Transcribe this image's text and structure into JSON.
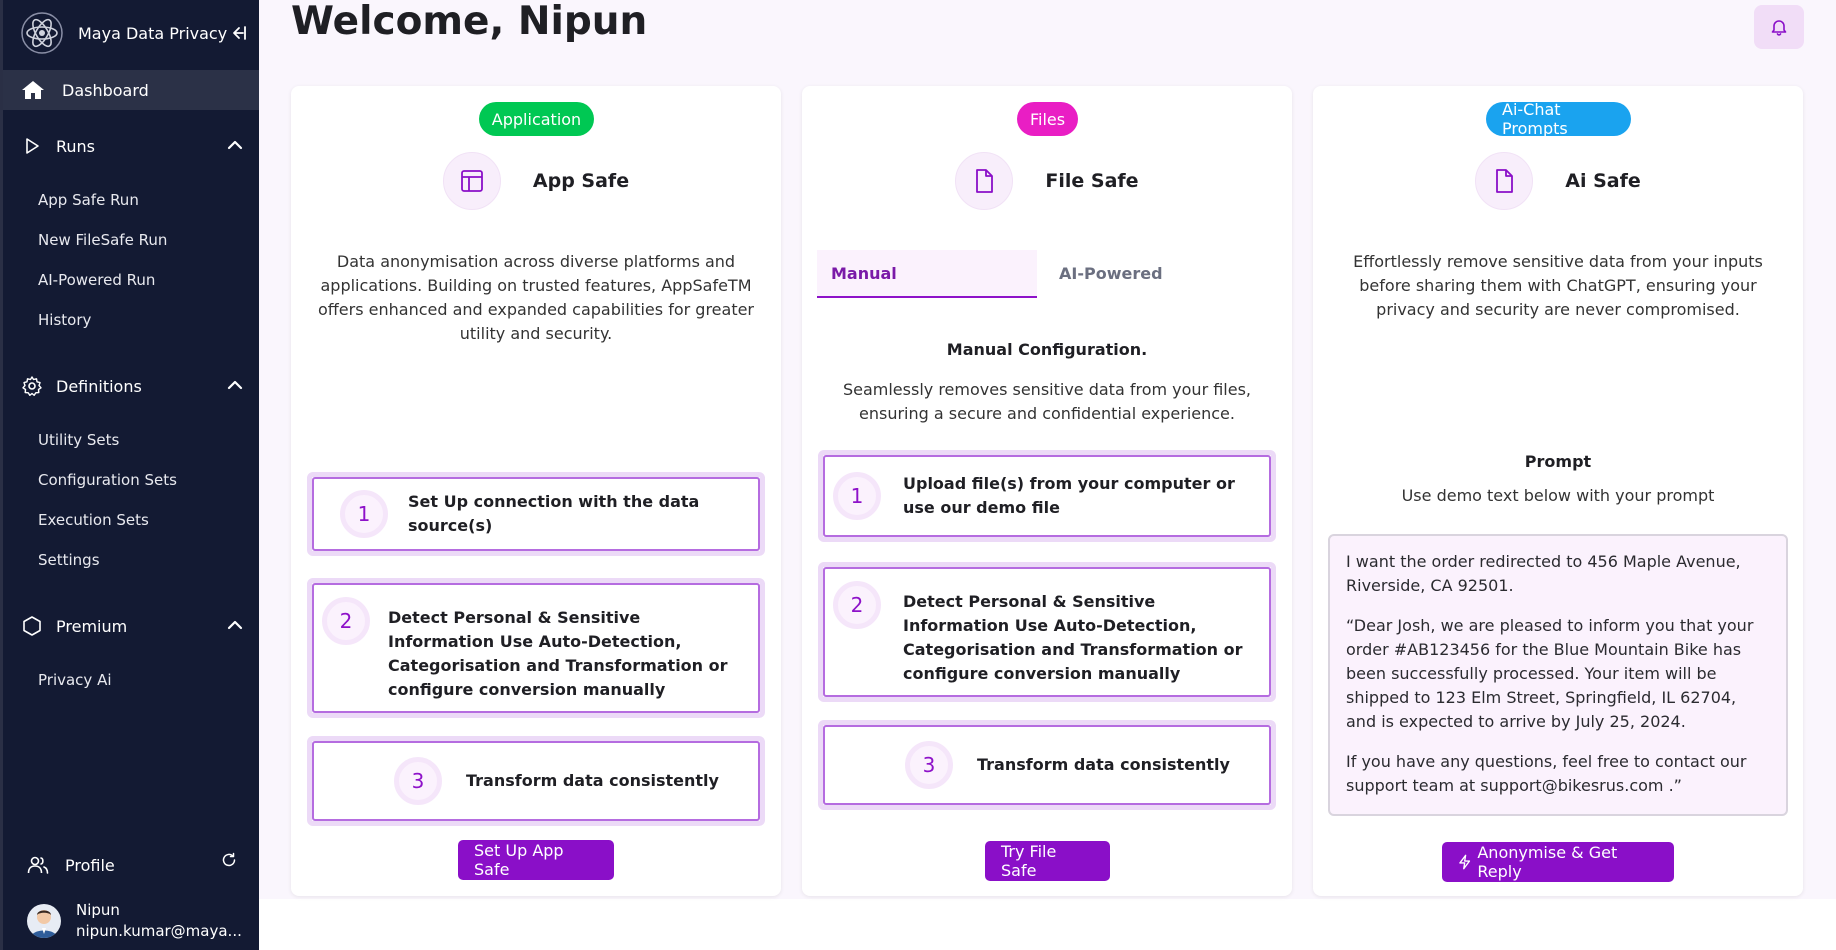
{
  "app": {
    "name": "Maya Data Privacy"
  },
  "sidebar": {
    "dashboard_label": "Dashboard",
    "runs": {
      "label": "Runs",
      "items": [
        "App Safe Run",
        "New FileSafe Run",
        "AI-Powered Run",
        "History"
      ]
    },
    "definitions": {
      "label": "Definitions",
      "items": [
        "Utility Sets",
        "Configuration Sets",
        "Execution Sets",
        "Settings"
      ]
    },
    "premium": {
      "label": "Premium",
      "items": [
        "Privacy Ai"
      ]
    },
    "profile_label": "Profile",
    "user": {
      "name": "Nipun",
      "email": "nipun.kumar@maya..."
    }
  },
  "header": {
    "title": "Welcome, Nipun"
  },
  "cards": {
    "app": {
      "pill": "Application",
      "title": "App Safe",
      "description": "Data anonymisation across diverse platforms and applications. Building on trusted features, AppSafeTM offers enhanced and expanded capabilities for greater utility and security.",
      "steps": [
        {
          "num": "1",
          "text": "Set Up connection with the data source(s)"
        },
        {
          "num": "2",
          "text": "Detect Personal & Sensitive Information Use Auto-Detection, Categorisation and Transformation or configure conversion manually"
        },
        {
          "num": "3",
          "text": "Transform data consistently"
        }
      ],
      "button": "Set Up App Safe"
    },
    "file": {
      "pill": "Files",
      "title": "File Safe",
      "tabs": [
        "Manual",
        "AI-Powered"
      ],
      "config_title": "Manual Configuration.",
      "description": "Seamlessly removes sensitive data from your files, ensuring a secure and confidential experience.",
      "steps": [
        {
          "num": "1",
          "text": "Upload file(s) from your computer or use our demo file"
        },
        {
          "num": "2",
          "text": "Detect Personal & Sensitive Information Use Auto-Detection, Categorisation and Transformation or configure conversion manually"
        },
        {
          "num": "3",
          "text": "Transform data consistently"
        }
      ],
      "button": "Try File Safe"
    },
    "ai": {
      "pill": "Ai-Chat Prompts",
      "title": "Ai Safe",
      "description": "Effortlessly remove sensitive data from your inputs before sharing them with ChatGPT, ensuring your privacy and security are never compromised.",
      "prompt_title": "Prompt",
      "prompt_subtitle": "Use demo text below with your prompt",
      "prompt_paragraphs": [
        "I want the order redirected to 456 Maple Avenue, Riverside, CA 92501.",
        "“Dear Josh, we are pleased to inform you that your order #AB123456 for the Blue Mountain Bike has been successfully processed. Your item will be shipped to 123 Elm Street, Springfield, IL 62704, and is expected to arrive by July 25, 2024.",
        "If you have any questions, feel free to contact our support team at support@bikesrus.com .”"
      ],
      "button": "Anonymise & Get Reply"
    }
  },
  "colors": {
    "sidebar_bg": "#131a33",
    "accent": "#8a0fc8",
    "pill_application": "#00c853",
    "pill_files": "#e91ec4",
    "pill_ai": "#1aa3ef"
  },
  "icons": [
    "atom-logo-icon",
    "collapse-sidebar-icon",
    "home-icon",
    "play-icon",
    "chevron-up-icon",
    "gear-icon",
    "hexagon-icon",
    "users-icon",
    "refresh-icon",
    "bell-icon",
    "layout-icon",
    "file-icon",
    "zap-icon"
  ]
}
